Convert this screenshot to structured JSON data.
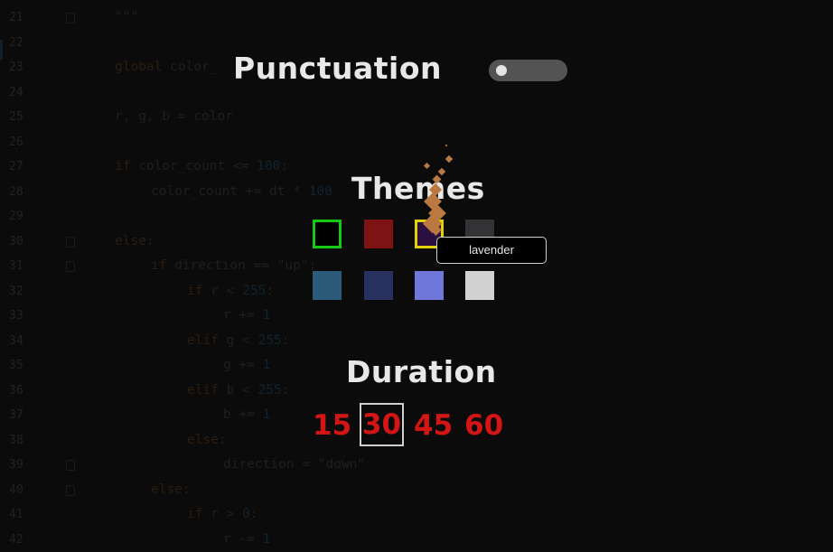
{
  "editor": {
    "lines": [
      {
        "num": "21",
        "indent": 0,
        "tokens": [
          {
            "t": "\"\"\"",
            "c": "str"
          }
        ]
      },
      {
        "num": "22",
        "indent": 0,
        "tokens": []
      },
      {
        "num": "23",
        "indent": 0,
        "tokens": [
          {
            "t": "global ",
            "c": "kw"
          },
          {
            "t": "color_",
            "c": "tx"
          }
        ]
      },
      {
        "num": "24",
        "indent": 0,
        "tokens": []
      },
      {
        "num": "25",
        "indent": 0,
        "tokens": [
          {
            "t": "r, g, b = color",
            "c": "tx"
          }
        ]
      },
      {
        "num": "26",
        "indent": 0,
        "tokens": []
      },
      {
        "num": "27",
        "indent": 0,
        "tokens": [
          {
            "t": "if ",
            "c": "kw"
          },
          {
            "t": "color_count <= ",
            "c": "tx"
          },
          {
            "t": "100",
            "c": "num"
          },
          {
            "t": ":",
            "c": "tx"
          }
        ]
      },
      {
        "num": "28",
        "indent": 1,
        "tokens": [
          {
            "t": "color_count += dt * ",
            "c": "tx"
          },
          {
            "t": "100",
            "c": "num"
          }
        ]
      },
      {
        "num": "29",
        "indent": 0,
        "tokens": []
      },
      {
        "num": "30",
        "indent": 0,
        "tokens": [
          {
            "t": "else",
            "c": "kw"
          },
          {
            "t": ":",
            "c": "tx"
          }
        ]
      },
      {
        "num": "31",
        "indent": 1,
        "tokens": [
          {
            "t": "if ",
            "c": "kw"
          },
          {
            "t": "direction == ",
            "c": "tx"
          },
          {
            "t": "\"up\"",
            "c": "str"
          },
          {
            "t": ":",
            "c": "tx"
          }
        ]
      },
      {
        "num": "32",
        "indent": 2,
        "tokens": [
          {
            "t": "if ",
            "c": "kw"
          },
          {
            "t": "r < ",
            "c": "tx"
          },
          {
            "t": "255",
            "c": "num"
          },
          {
            "t": ":",
            "c": "tx"
          }
        ]
      },
      {
        "num": "33",
        "indent": 3,
        "tokens": [
          {
            "t": "r += ",
            "c": "tx"
          },
          {
            "t": "1",
            "c": "num"
          }
        ]
      },
      {
        "num": "34",
        "indent": 2,
        "tokens": [
          {
            "t": "elif ",
            "c": "kw"
          },
          {
            "t": "g < ",
            "c": "tx"
          },
          {
            "t": "255",
            "c": "num"
          },
          {
            "t": ":",
            "c": "tx"
          }
        ]
      },
      {
        "num": "35",
        "indent": 3,
        "tokens": [
          {
            "t": "g += ",
            "c": "tx"
          },
          {
            "t": "1",
            "c": "num"
          }
        ]
      },
      {
        "num": "36",
        "indent": 2,
        "tokens": [
          {
            "t": "elif ",
            "c": "kw"
          },
          {
            "t": "b < ",
            "c": "tx"
          },
          {
            "t": "255",
            "c": "num"
          },
          {
            "t": ":",
            "c": "tx"
          }
        ]
      },
      {
        "num": "37",
        "indent": 3,
        "tokens": [
          {
            "t": "b += ",
            "c": "tx"
          },
          {
            "t": "1",
            "c": "num"
          }
        ]
      },
      {
        "num": "38",
        "indent": 2,
        "tokens": [
          {
            "t": "else",
            "c": "kw"
          },
          {
            "t": ":",
            "c": "tx"
          }
        ]
      },
      {
        "num": "39",
        "indent": 3,
        "tokens": [
          {
            "t": "direction = ",
            "c": "tx"
          },
          {
            "t": "\"down\"",
            "c": "str"
          }
        ]
      },
      {
        "num": "40",
        "indent": 1,
        "tokens": [
          {
            "t": "else",
            "c": "kw"
          },
          {
            "t": ":",
            "c": "tx"
          }
        ]
      },
      {
        "num": "41",
        "indent": 2,
        "tokens": [
          {
            "t": "if ",
            "c": "kw"
          },
          {
            "t": "r > ",
            "c": "tx"
          },
          {
            "t": "0",
            "c": "num"
          },
          {
            "t": ":",
            "c": "tx"
          }
        ]
      },
      {
        "num": "42",
        "indent": 3,
        "tokens": [
          {
            "t": "r -= ",
            "c": "tx"
          },
          {
            "t": "1",
            "c": "num"
          }
        ]
      }
    ],
    "fold_lines": [
      "21",
      "30",
      "31",
      "39",
      "40"
    ]
  },
  "settings": {
    "punctuation": {
      "label": "Punctuation",
      "enabled": false
    },
    "themes": {
      "label": "Themes",
      "swatches": [
        {
          "name": "black",
          "color": "#000000",
          "selected": true
        },
        {
          "name": "crimson",
          "color": "#7e1313",
          "selected": false
        },
        {
          "name": "lavender",
          "color": "#2b0f3e",
          "hover": true
        },
        {
          "name": "charcoal",
          "color": "#333335",
          "selected": false
        },
        {
          "name": "steel-blue",
          "color": "#2b5b78",
          "selected": false
        },
        {
          "name": "navy",
          "color": "#27305f",
          "selected": false
        },
        {
          "name": "periwinkle",
          "color": "#6f78d9",
          "selected": false
        },
        {
          "name": "light-gray",
          "color": "#d2d2d2",
          "selected": false
        }
      ],
      "tooltip": "lavender"
    },
    "duration": {
      "label": "Duration",
      "options": [
        "15",
        "30",
        "45",
        "60"
      ],
      "selected": "30"
    }
  }
}
